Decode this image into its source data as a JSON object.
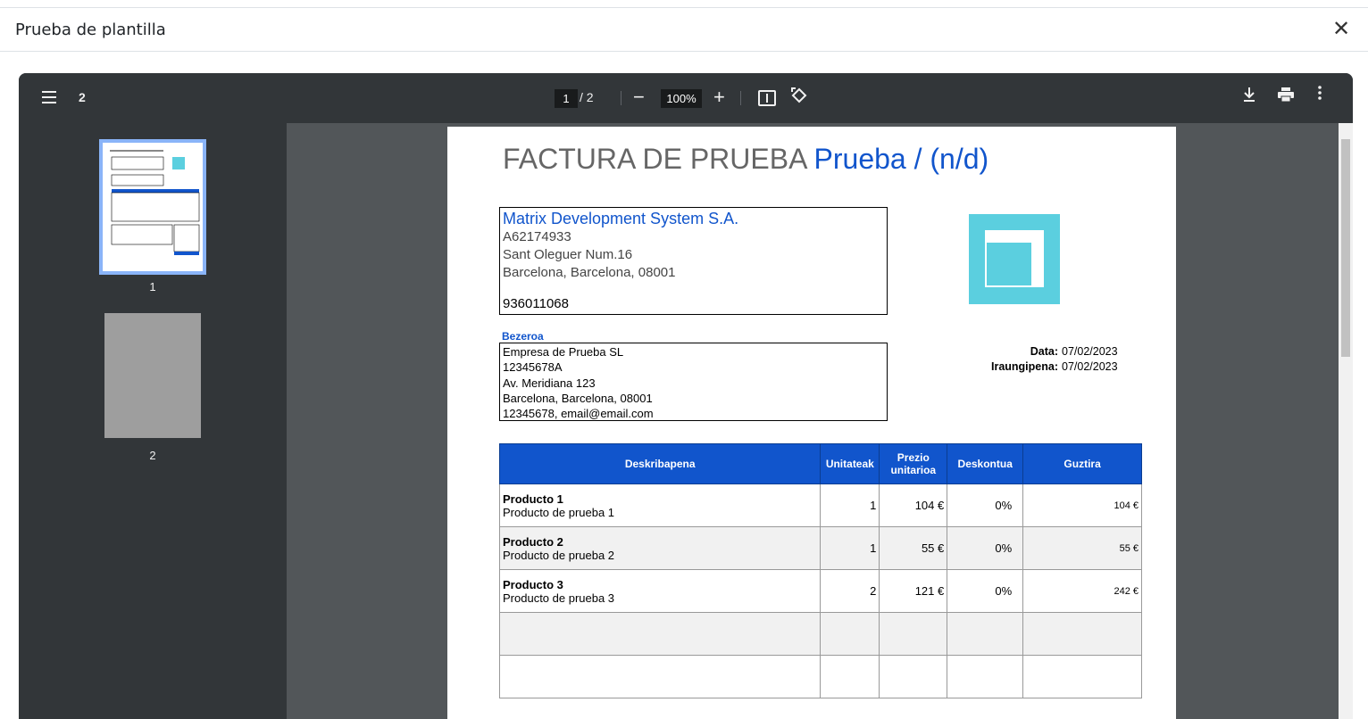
{
  "modal": {
    "title": "Prueba de plantilla",
    "close_symbol": "✕"
  },
  "toolbar": {
    "doc_label": "2",
    "current_page": "1",
    "page_separator": "/ 2",
    "zoom_out": "−",
    "zoom": "100%",
    "zoom_in": "+",
    "icons": [
      "menu-icon",
      "fit-page-icon",
      "rotate-icon",
      "download-icon",
      "print-icon",
      "more-icon"
    ]
  },
  "sidebar": {
    "thumbnails": [
      {
        "label": "1"
      },
      {
        "label": "2"
      }
    ]
  },
  "invoice": {
    "title_main": "FACTURA DE PRUEBA",
    "title_accent": "Prueba / (n/d)",
    "seller": {
      "name": "Matrix Development System S.A.",
      "tax_id": "A62174933",
      "address": "Sant Oleguer  Num.16",
      "city": "Barcelona, Barcelona, 08001",
      "phone": "936011068"
    },
    "client_label": "Bezeroa",
    "client": {
      "name": "Empresa de Prueba SL",
      "tax_id": "12345678A",
      "address": "Av. Meridiana 123",
      "city": "Barcelona, Barcelona, 08001",
      "contact": "12345678, email@email.com"
    },
    "meta": {
      "date_label": "Data:",
      "date_value": "07/02/2023",
      "due_label": "Iraungipena:",
      "due_value": "07/02/2023"
    },
    "table": {
      "headers": [
        "Deskribapena",
        "Unitateak",
        "Prezio unitarioa",
        "Deskontua",
        "Guztira"
      ],
      "rows": [
        {
          "name": "Producto 1",
          "desc": "Producto de prueba 1",
          "units": "1",
          "price": "104 €",
          "discount": "0%",
          "total": "104 €"
        },
        {
          "name": "Producto 2",
          "desc": "Producto de prueba 2",
          "units": "1",
          "price": "55 €",
          "discount": "0%",
          "total": "55 €"
        },
        {
          "name": "Producto 3",
          "desc": "Producto de prueba 3",
          "units": "2",
          "price": "121 €",
          "discount": "0%",
          "total": "242 €"
        }
      ]
    }
  },
  "colors": {
    "accent": "#1155cc",
    "logo": "#5bcfdf",
    "toolbar": "#323639",
    "viewer_bg": "#525659"
  }
}
